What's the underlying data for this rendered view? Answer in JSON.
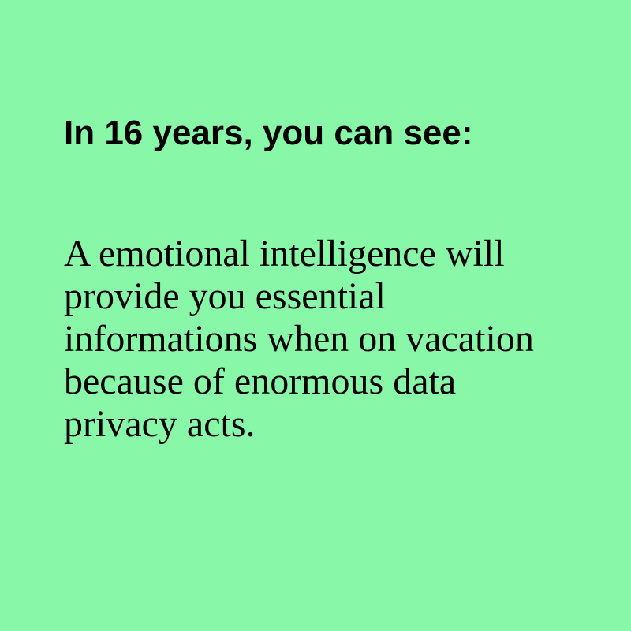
{
  "colors": {
    "background": "#88f8a8",
    "text": "#000000"
  },
  "card": {
    "heading": "In 16 years, you can see:",
    "body": "A emotional intelligence will provide you essential informations when on vacation because of enormous data privacy acts."
  }
}
